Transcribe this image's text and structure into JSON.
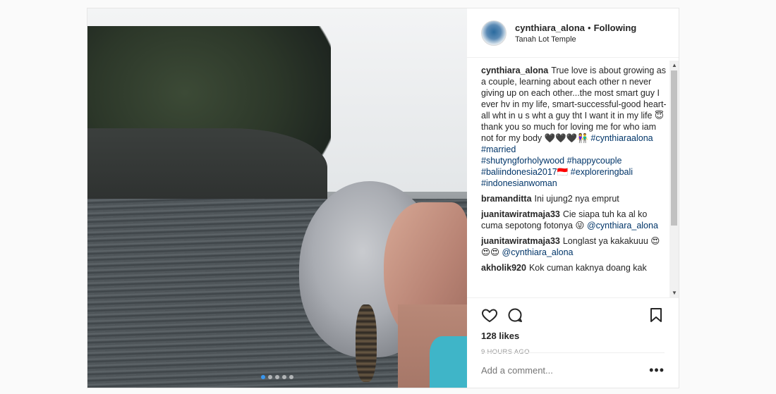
{
  "header": {
    "username": "cynthiara_alona",
    "separator": "•",
    "follow_status": "Following",
    "location": "Tanah Lot Temple"
  },
  "comments": [
    {
      "user": "cynthiara_alona",
      "text": "True love is about growing as a couple, learning about each other n never giving up on each other...the most smart guy I ever hv in my life, smart-successful-good heart- all wht in u s wht a guy tht I want it in my life 😇thank you so much for loving me for who iam not for my body 🖤🖤🖤👫",
      "tags": [
        "#cynthiaraalona",
        "#married",
        "#shutyngforholywood",
        "#happycouple",
        "#baliindonesia2017🇮🇩",
        "#exploreringbali",
        "#indonesianwoman"
      ]
    },
    {
      "user": "bramanditta",
      "text": "Ini ujung2 nya emprut",
      "tags": []
    },
    {
      "user": "juanitawiratmaja33",
      "text": "Cie siapa tuh ka al ko cuma sepotong fotonya 😜",
      "tags": [
        "@cynthiara_alona"
      ]
    },
    {
      "user": "juanitawiratmaja33",
      "text": "Longlast ya kakakuuu 😍😍😍",
      "tags": [
        "@cynthiara_alona"
      ]
    },
    {
      "user": "akholik920",
      "text": "Kok cuman kaknya doang kak",
      "tags": []
    }
  ],
  "actions": {
    "likes": "128 likes",
    "time": "9 HOURS AGO",
    "comment_placeholder": "Add a comment...",
    "more_label": "•••"
  },
  "icons": {
    "like": "heart-icon",
    "comment": "comment-bubble-icon",
    "save": "bookmark-icon",
    "more": "more-options-icon"
  },
  "carousel": {
    "total": 5,
    "active": 1
  },
  "colors": {
    "accent": "#3897f0",
    "tag": "#003569"
  }
}
